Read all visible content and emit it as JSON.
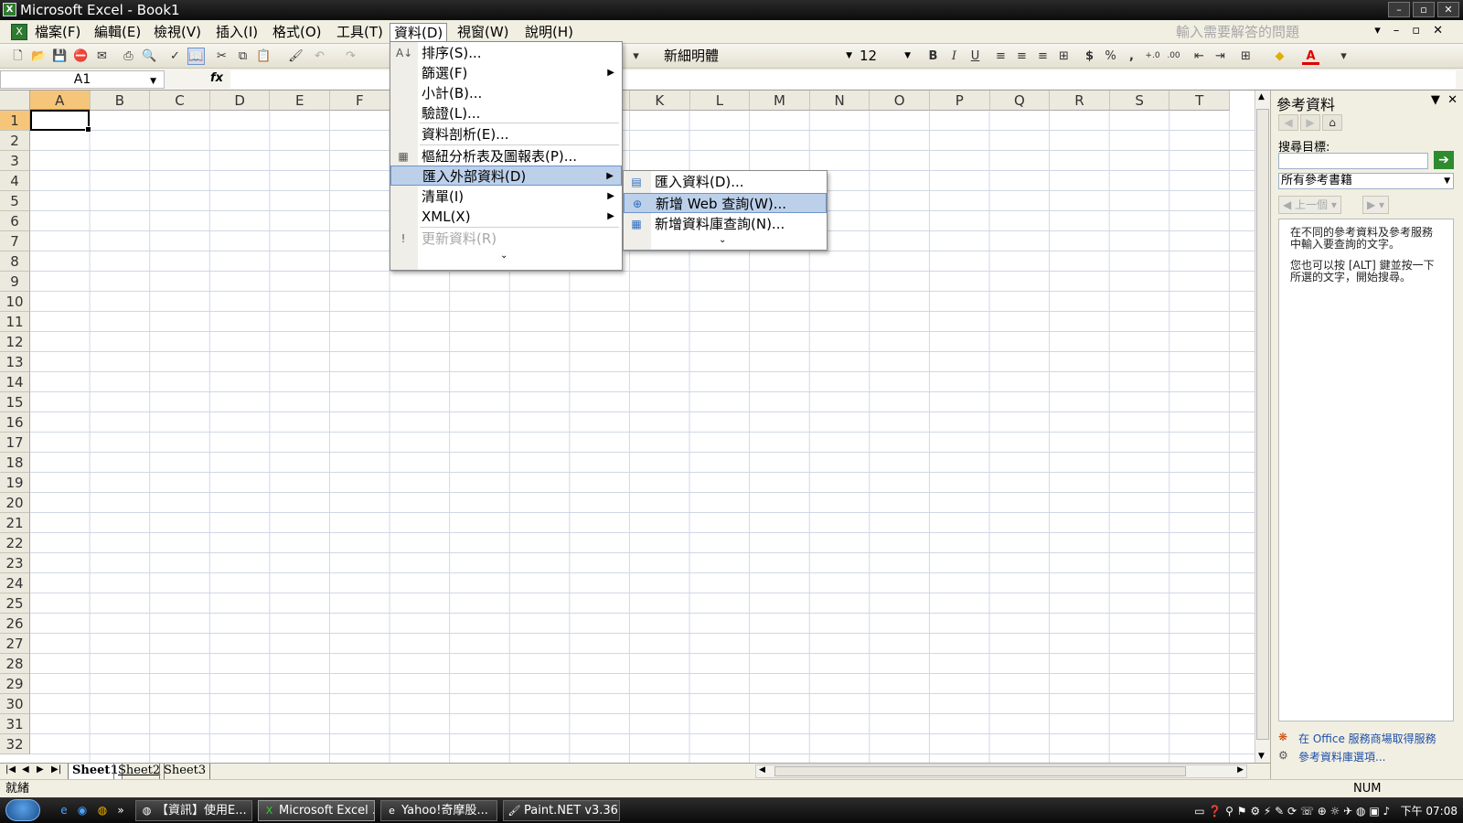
{
  "window": {
    "title": "Microsoft Excel - Book1",
    "app_icon": "excel-icon"
  },
  "menubar": {
    "items": [
      "檔案(F)",
      "編輯(E)",
      "檢視(V)",
      "插入(I)",
      "格式(O)",
      "工具(T)",
      "資料(D)",
      "視窗(W)",
      "說明(H)"
    ],
    "help_placeholder": "輸入需要解答的問題"
  },
  "toolbar": {
    "font_name": "新細明體",
    "font_size": "12",
    "bold": "B",
    "italic": "I",
    "underline": "U",
    "currency": "$",
    "percent": "%",
    "comma": ","
  },
  "formula_bar": {
    "name_box": "A1",
    "fx": "fx",
    "value": ""
  },
  "sheet": {
    "columns": [
      "A",
      "B",
      "C",
      "D",
      "E",
      "F",
      "G",
      "H",
      "I",
      "J",
      "K",
      "L",
      "M",
      "N",
      "O",
      "P",
      "Q",
      "R",
      "S",
      "T"
    ],
    "rows": [
      "1",
      "2",
      "3",
      "4",
      "5",
      "6",
      "7",
      "8",
      "9",
      "10",
      "11",
      "12",
      "13",
      "14",
      "15",
      "16",
      "17",
      "18",
      "19",
      "20",
      "21",
      "22",
      "23",
      "24",
      "25",
      "26",
      "27",
      "28",
      "29",
      "30",
      "31",
      "32"
    ],
    "active_cell": "A1",
    "tabs": [
      "Sheet1",
      "Sheet2",
      "Sheet3"
    ]
  },
  "data_menu": {
    "items": [
      {
        "label": "排序(S)...",
        "icon": "sort-icon"
      },
      {
        "label": "篩選(F)",
        "submenu": true
      },
      {
        "label": "小計(B)..."
      },
      {
        "label": "驗證(L)..."
      },
      {
        "label": "資料剖析(E)..."
      },
      {
        "label": "樞紐分析表及圖報表(P)...",
        "icon": "pivot-icon"
      },
      {
        "label": "匯入外部資料(D)",
        "submenu": true,
        "highlighted": true
      },
      {
        "label": "清單(I)",
        "submenu": true
      },
      {
        "label": "XML(X)",
        "submenu": true
      },
      {
        "label": "更新資料(R)",
        "disabled": true,
        "icon": "refresh-icon"
      }
    ]
  },
  "import_submenu": {
    "items": [
      {
        "label": "匯入資料(D)...",
        "icon": "import-data-icon"
      },
      {
        "label": "新增 Web 查詢(W)...",
        "icon": "web-query-icon",
        "highlighted": true
      },
      {
        "label": "新增資料庫查詢(N)...",
        "icon": "database-query-icon"
      }
    ]
  },
  "research_pane": {
    "title": "參考資料",
    "search_label": "搜尋目標:",
    "search_value": "",
    "source_select": "所有參考書籍",
    "back_label": "上一個",
    "info_line1": "在不同的參考資料及參考服務中輸入要查詢的文字。",
    "info_line2": "您也可以按 [ALT] 鍵並按一下所選的文字，開始搜尋。",
    "link1": "在 Office 服務商場取得服務",
    "link2": "參考資料庫選項..."
  },
  "statusbar": {
    "left": "就緒",
    "num": "NUM"
  },
  "taskbar": {
    "buttons": [
      "【資訊】使用E...",
      "Microsoft Excel ...",
      "Yahoo!奇摩股...",
      "Paint.NET v3.36"
    ],
    "clock": "下午 07:08"
  },
  "colors": {
    "selection_header": "#f5c67a",
    "menu_highlight": "#bcd0ea",
    "link": "#1f4fa8"
  }
}
